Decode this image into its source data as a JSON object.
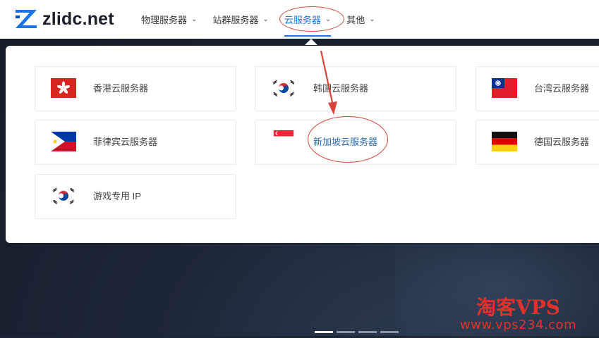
{
  "header": {
    "logo_text": "zlidc.net",
    "nav": [
      {
        "label": "物理服务器",
        "has_dropdown": true
      },
      {
        "label": "站群服务器",
        "has_dropdown": true
      },
      {
        "label": "云服务器",
        "has_dropdown": true,
        "active": true
      },
      {
        "label": "其他",
        "has_dropdown": true
      }
    ]
  },
  "menu": {
    "items": [
      {
        "label": "香港云服务器",
        "flag": "hong-kong-flag-icon"
      },
      {
        "label": "韩国云服务器",
        "flag": "south-korea-flag-icon"
      },
      {
        "label": "台湾云服务器",
        "flag": "taiwan-flag-icon"
      },
      {
        "label": "菲律宾云服务器",
        "flag": "philippines-flag-icon"
      },
      {
        "label": "新加坡云服务器",
        "flag": "singapore-flag-icon",
        "highlighted": true
      },
      {
        "label": "德国云服务器",
        "flag": "germany-flag-icon"
      },
      {
        "label": "游戏专用 IP",
        "flag": "south-korea-flag-icon"
      }
    ]
  },
  "annotation": {
    "color": "#d9443a"
  },
  "slider": {
    "count": 4,
    "active_index": 0
  },
  "watermark": {
    "line1": "淘客VPS",
    "line2": "www.vps234.com"
  },
  "colors": {
    "accent": "#1a73e8",
    "annotation_red": "#d9443a",
    "watermark_red": "#e0322b"
  }
}
